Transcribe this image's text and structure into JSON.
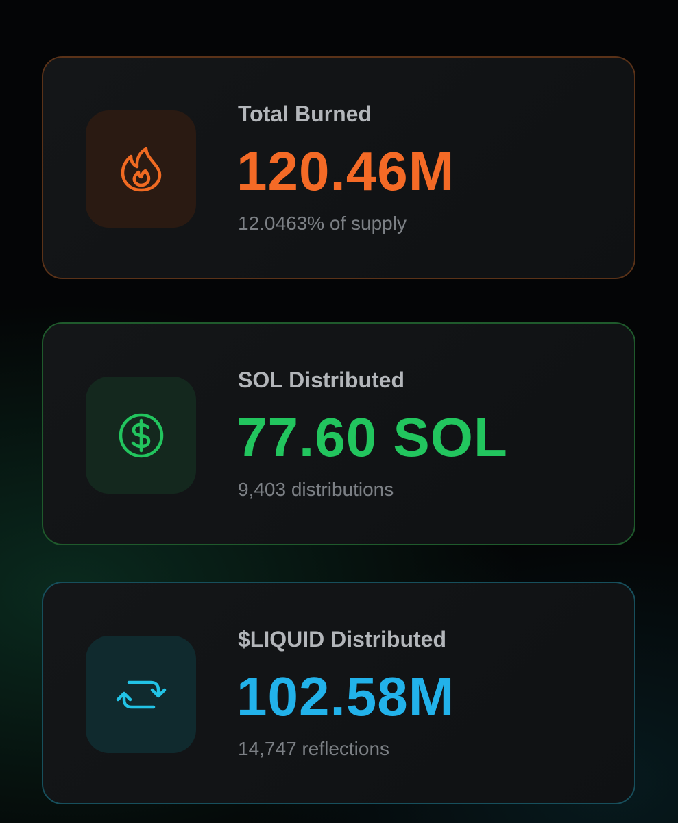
{
  "cards": [
    {
      "label": "Total Burned",
      "value": "120.46M",
      "sub": "12.0463% of supply",
      "icon": "flame-icon",
      "accent": "#f46a26"
    },
    {
      "label": "SOL Distributed",
      "value": "77.60 SOL",
      "sub": "9,403 distributions",
      "icon": "dollar-circle-icon",
      "accent": "#22c55e"
    },
    {
      "label": "$LIQUID Distributed",
      "value": "102.58M",
      "sub": "14,747 reflections",
      "icon": "refresh-arrows-icon",
      "accent": "#22b2ea"
    }
  ]
}
